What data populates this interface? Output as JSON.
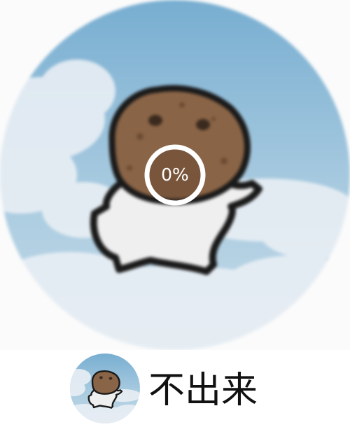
{
  "upload": {
    "progress_text": "0%",
    "progress_fraction": 0.0
  },
  "user": {
    "name": "不出来",
    "avatar_icon": "potato-head-character-sky-avatar"
  },
  "colors": {
    "sky_top": "#7fb2d3",
    "sky_bottom": "#bcd6e6",
    "cloud": "#e7eef3",
    "head": "#8a6446",
    "body": "#efefef",
    "outline": "#1a1a1a",
    "ring": "#ffffff",
    "text": "#111111"
  }
}
